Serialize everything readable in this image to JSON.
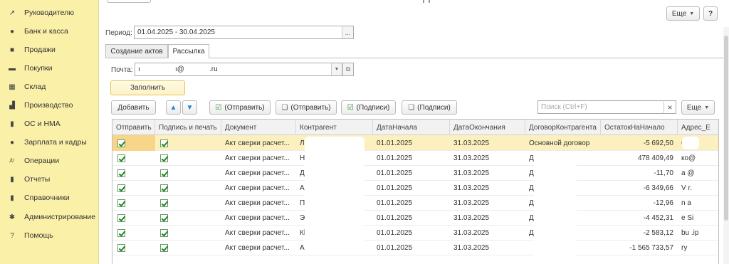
{
  "sidebar": {
    "items": [
      {
        "icon": "trend-icon",
        "glyph": "↗",
        "label": "Руководителю"
      },
      {
        "icon": "coin-icon",
        "glyph": "●",
        "label": "Банк и касса"
      },
      {
        "icon": "bag-icon",
        "glyph": "■",
        "label": "Продажи"
      },
      {
        "icon": "cart-icon",
        "glyph": "▬",
        "label": "Покупки"
      },
      {
        "icon": "grid-icon",
        "glyph": "▦",
        "label": "Склад"
      },
      {
        "icon": "factory-icon",
        "glyph": "▟",
        "label": "Производство"
      },
      {
        "icon": "truck-icon",
        "glyph": "▮",
        "label": "ОС и НМА"
      },
      {
        "icon": "people-icon",
        "glyph": "●",
        "label": "Зарплата и кадры"
      },
      {
        "icon": "dt-kt-icon",
        "glyph": "Дт",
        "label": "Операции"
      },
      {
        "icon": "bar-chart-icon",
        "glyph": "▮",
        "label": "Отчеты"
      },
      {
        "icon": "book-icon",
        "glyph": "▮",
        "label": "Справочники"
      },
      {
        "icon": "gear-icon",
        "glyph": "✱",
        "label": "Администрирование"
      },
      {
        "icon": "help-icon",
        "glyph": "?",
        "label": "Помощь"
      }
    ]
  },
  "toolbar_top": {
    "more_label": "Еще",
    "help_label": "?"
  },
  "period": {
    "label": "Период:",
    "value": "01.04.2025 - 30.04.2025",
    "picker": "..."
  },
  "tabs": [
    {
      "label": "Создание актов",
      "active": false
    },
    {
      "label": "Рассылка",
      "active": true
    }
  ],
  "mail": {
    "label": "Почта:",
    "value_part1": "ı",
    "value_part2": "ı@",
    "value_part3": ".ru"
  },
  "fill_button": "Заполнить",
  "toolbar": {
    "add": "Добавить",
    "send1": "(Отправить)",
    "send2": "(Отправить)",
    "sign1": "(Подписи)",
    "sign2": "(Подписи)",
    "search_placeholder": "Поиск (Ctrl+F)",
    "clear": "×",
    "more": "Еще"
  },
  "table": {
    "columns": [
      "Отправить",
      "Подпись и печать",
      "Документ",
      "Контрагент",
      "ДатаНачала",
      "ДатаОкончания",
      "ДоговорКонтрагента",
      "ОстатокНаНачало",
      "Адрес_Е"
    ],
    "rows": [
      {
        "doc": "Акт сверки расчет...",
        "counterparty": "Лс",
        "start": "01.01.2025",
        "end": "31.03.2025",
        "contract": "Основной договор",
        "balance": "-5 692,50",
        "address": "63"
      },
      {
        "doc": "Акт сверки расчет...",
        "counterparty": "Н",
        "start": "01.01.2025",
        "end": "31.03.2025",
        "contract": "Договор № 19",
        "balance": "478 409,49",
        "address": "ко@"
      },
      {
        "doc": "Акт сверки расчет...",
        "counterparty": "Д",
        "start": "01.01.2025",
        "end": "31.03.2025",
        "contract": "Договор № 25",
        "balance": "-11,70",
        "address": "а    @"
      },
      {
        "doc": "Акт сверки расчет...",
        "counterparty": "А",
        "start": "01.01.2025",
        "end": "31.03.2025",
        "contract": "Договор № 19",
        "balance": "-6 349,66",
        "address": "V    r."
      },
      {
        "doc": "Акт сверки расчет...",
        "counterparty": "П.",
        "start": "01.01.2025",
        "end": "31.03.2025",
        "contract": "Договор № 14",
        "balance": "-12,96",
        "address": "n    a"
      },
      {
        "doc": "Акт сверки расчет...",
        "counterparty": "Э",
        "start": "01.01.2025",
        "end": "31.03.2025",
        "contract": "Договор № 19",
        "balance": "-4 452,31",
        "address": "e    Si"
      },
      {
        "doc": "Акт сверки расчет...",
        "counterparty": "Кl",
        "start": "01.01.2025",
        "end": "31.03.2025",
        "contract": "Договору пост",
        "balance": "-2 583,12",
        "address": "bu   .ip"
      },
      {
        "doc": "Акт сверки расчет...",
        "counterparty": "Al",
        "start": "01.01.2025",
        "end": "31.03.2025",
        "contract": "",
        "balance": "-1 565 733,57",
        "address": "    ry"
      }
    ]
  },
  "colors": {
    "sidebar_bg": "#fbf0a8",
    "selected_row": "#fcf0be",
    "check_green": "#1e8a1e",
    "arrow_blue": "#2f7fd0"
  }
}
